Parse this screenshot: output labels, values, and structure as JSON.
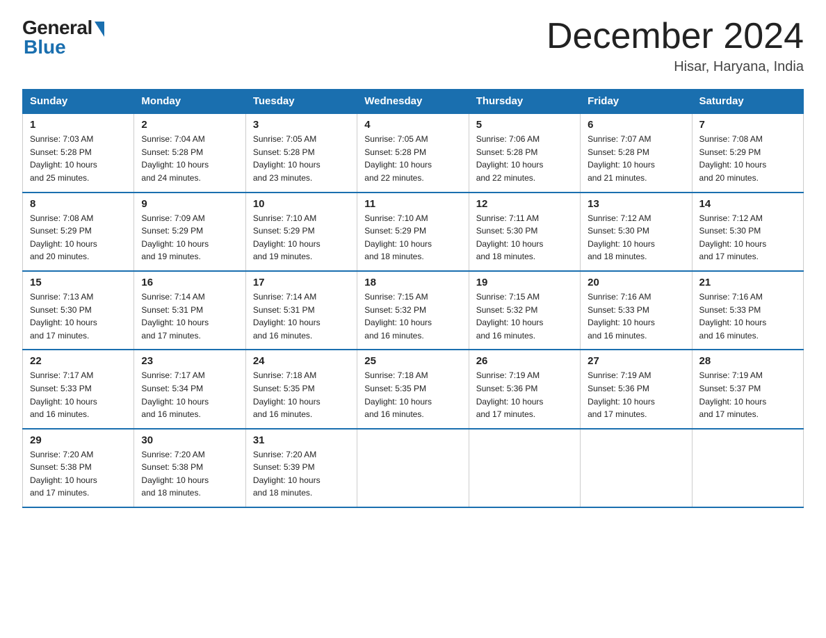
{
  "header": {
    "logo_general": "General",
    "logo_blue": "Blue",
    "title": "December 2024",
    "location": "Hisar, Haryana, India"
  },
  "days_of_week": [
    "Sunday",
    "Monday",
    "Tuesday",
    "Wednesday",
    "Thursday",
    "Friday",
    "Saturday"
  ],
  "weeks": [
    [
      {
        "day": "1",
        "info": "Sunrise: 7:03 AM\nSunset: 5:28 PM\nDaylight: 10 hours\nand 25 minutes."
      },
      {
        "day": "2",
        "info": "Sunrise: 7:04 AM\nSunset: 5:28 PM\nDaylight: 10 hours\nand 24 minutes."
      },
      {
        "day": "3",
        "info": "Sunrise: 7:05 AM\nSunset: 5:28 PM\nDaylight: 10 hours\nand 23 minutes."
      },
      {
        "day": "4",
        "info": "Sunrise: 7:05 AM\nSunset: 5:28 PM\nDaylight: 10 hours\nand 22 minutes."
      },
      {
        "day": "5",
        "info": "Sunrise: 7:06 AM\nSunset: 5:28 PM\nDaylight: 10 hours\nand 22 minutes."
      },
      {
        "day": "6",
        "info": "Sunrise: 7:07 AM\nSunset: 5:28 PM\nDaylight: 10 hours\nand 21 minutes."
      },
      {
        "day": "7",
        "info": "Sunrise: 7:08 AM\nSunset: 5:29 PM\nDaylight: 10 hours\nand 20 minutes."
      }
    ],
    [
      {
        "day": "8",
        "info": "Sunrise: 7:08 AM\nSunset: 5:29 PM\nDaylight: 10 hours\nand 20 minutes."
      },
      {
        "day": "9",
        "info": "Sunrise: 7:09 AM\nSunset: 5:29 PM\nDaylight: 10 hours\nand 19 minutes."
      },
      {
        "day": "10",
        "info": "Sunrise: 7:10 AM\nSunset: 5:29 PM\nDaylight: 10 hours\nand 19 minutes."
      },
      {
        "day": "11",
        "info": "Sunrise: 7:10 AM\nSunset: 5:29 PM\nDaylight: 10 hours\nand 18 minutes."
      },
      {
        "day": "12",
        "info": "Sunrise: 7:11 AM\nSunset: 5:30 PM\nDaylight: 10 hours\nand 18 minutes."
      },
      {
        "day": "13",
        "info": "Sunrise: 7:12 AM\nSunset: 5:30 PM\nDaylight: 10 hours\nand 18 minutes."
      },
      {
        "day": "14",
        "info": "Sunrise: 7:12 AM\nSunset: 5:30 PM\nDaylight: 10 hours\nand 17 minutes."
      }
    ],
    [
      {
        "day": "15",
        "info": "Sunrise: 7:13 AM\nSunset: 5:30 PM\nDaylight: 10 hours\nand 17 minutes."
      },
      {
        "day": "16",
        "info": "Sunrise: 7:14 AM\nSunset: 5:31 PM\nDaylight: 10 hours\nand 17 minutes."
      },
      {
        "day": "17",
        "info": "Sunrise: 7:14 AM\nSunset: 5:31 PM\nDaylight: 10 hours\nand 16 minutes."
      },
      {
        "day": "18",
        "info": "Sunrise: 7:15 AM\nSunset: 5:32 PM\nDaylight: 10 hours\nand 16 minutes."
      },
      {
        "day": "19",
        "info": "Sunrise: 7:15 AM\nSunset: 5:32 PM\nDaylight: 10 hours\nand 16 minutes."
      },
      {
        "day": "20",
        "info": "Sunrise: 7:16 AM\nSunset: 5:33 PM\nDaylight: 10 hours\nand 16 minutes."
      },
      {
        "day": "21",
        "info": "Sunrise: 7:16 AM\nSunset: 5:33 PM\nDaylight: 10 hours\nand 16 minutes."
      }
    ],
    [
      {
        "day": "22",
        "info": "Sunrise: 7:17 AM\nSunset: 5:33 PM\nDaylight: 10 hours\nand 16 minutes."
      },
      {
        "day": "23",
        "info": "Sunrise: 7:17 AM\nSunset: 5:34 PM\nDaylight: 10 hours\nand 16 minutes."
      },
      {
        "day": "24",
        "info": "Sunrise: 7:18 AM\nSunset: 5:35 PM\nDaylight: 10 hours\nand 16 minutes."
      },
      {
        "day": "25",
        "info": "Sunrise: 7:18 AM\nSunset: 5:35 PM\nDaylight: 10 hours\nand 16 minutes."
      },
      {
        "day": "26",
        "info": "Sunrise: 7:19 AM\nSunset: 5:36 PM\nDaylight: 10 hours\nand 17 minutes."
      },
      {
        "day": "27",
        "info": "Sunrise: 7:19 AM\nSunset: 5:36 PM\nDaylight: 10 hours\nand 17 minutes."
      },
      {
        "day": "28",
        "info": "Sunrise: 7:19 AM\nSunset: 5:37 PM\nDaylight: 10 hours\nand 17 minutes."
      }
    ],
    [
      {
        "day": "29",
        "info": "Sunrise: 7:20 AM\nSunset: 5:38 PM\nDaylight: 10 hours\nand 17 minutes."
      },
      {
        "day": "30",
        "info": "Sunrise: 7:20 AM\nSunset: 5:38 PM\nDaylight: 10 hours\nand 18 minutes."
      },
      {
        "day": "31",
        "info": "Sunrise: 7:20 AM\nSunset: 5:39 PM\nDaylight: 10 hours\nand 18 minutes."
      },
      null,
      null,
      null,
      null
    ]
  ]
}
